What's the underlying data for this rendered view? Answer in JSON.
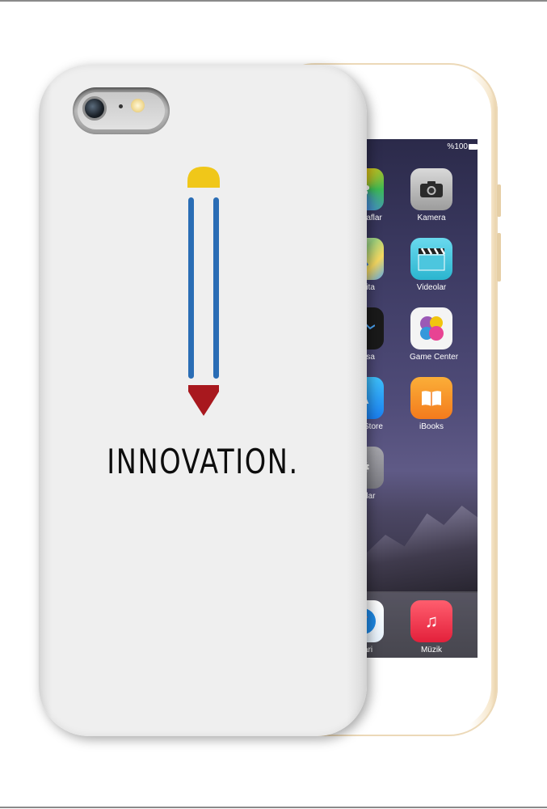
{
  "screen": {
    "status": "%100",
    "apps": [
      {
        "id": "photos",
        "label": "raflar",
        "icon": "photos-icon",
        "color": "#f5f5f5"
      },
      {
        "id": "camera",
        "label": "Kamera",
        "icon": "camera-icon",
        "color": "#b9b9b9"
      },
      {
        "id": "maps",
        "label": "rita",
        "icon": "maps-icon",
        "color": "#7cc36b"
      },
      {
        "id": "videos",
        "label": "Videolar",
        "icon": "video-clapper-icon",
        "color": "#3ec6d9"
      },
      {
        "id": "stocks",
        "label": "rsa",
        "icon": "stocks-icon",
        "color": "#1b1b1b"
      },
      {
        "id": "gamecenter",
        "label": "Game Center",
        "icon": "game-center-icon",
        "color": "#f2f2f2"
      },
      {
        "id": "appstore",
        "label": "Store",
        "icon": "app-store-icon",
        "color": "#1e90f0"
      },
      {
        "id": "ibooks",
        "label": "iBooks",
        "icon": "book-icon",
        "color": "#f58a1f"
      },
      {
        "id": "settings",
        "label": "rlar",
        "icon": "settings-gear-icon",
        "color": "#8e8e93"
      },
      {
        "id": "safari",
        "label": "ari",
        "icon": "compass-icon",
        "color": "#1e88e5"
      },
      {
        "id": "music",
        "label": "Müzik",
        "icon": "music-note-icon",
        "color": "#f2394f"
      }
    ]
  },
  "case": {
    "slogan": "INNOVATION.",
    "pencil_colors": {
      "eraser": "#f0c719",
      "body": "#2a6db5",
      "tip": "#a8181e"
    }
  }
}
